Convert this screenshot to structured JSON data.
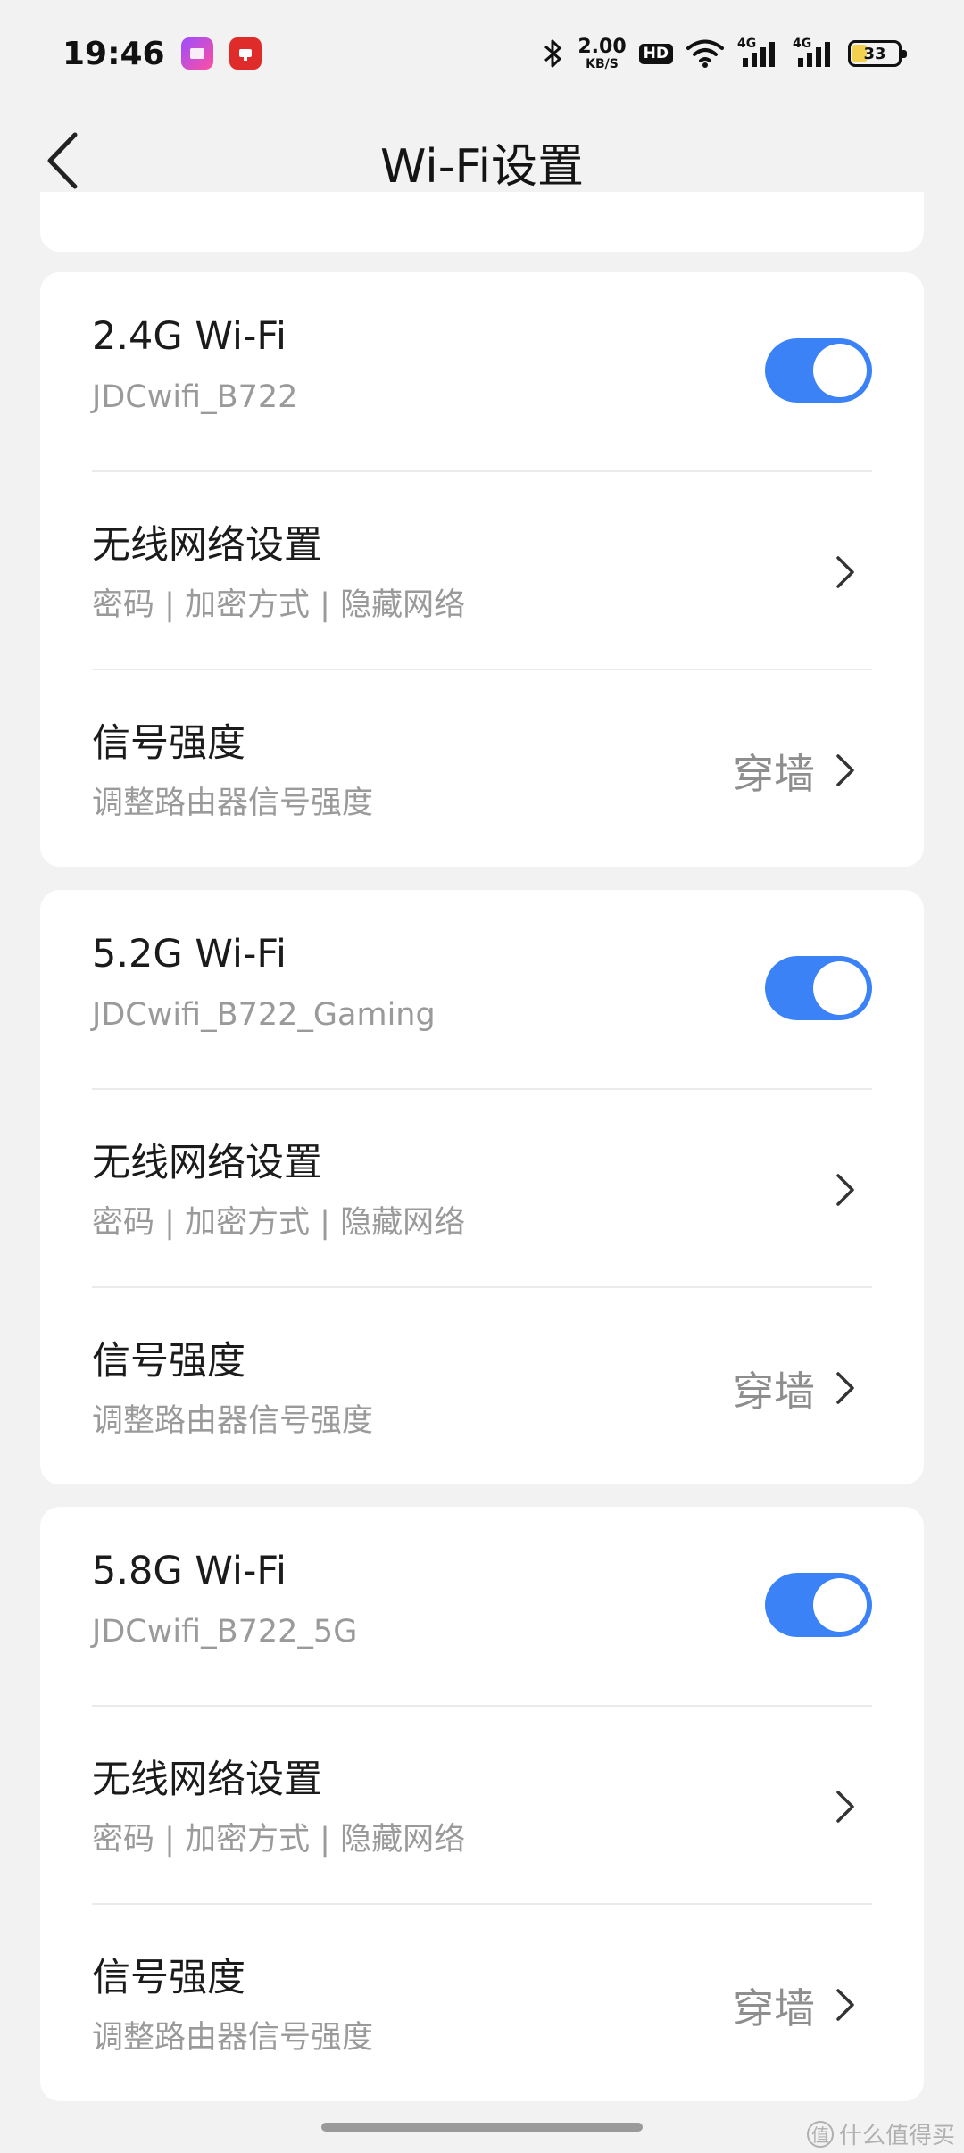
{
  "status_bar": {
    "time": "19:46",
    "net_speed_value": "2.00",
    "net_speed_unit": "KB/S",
    "hd_label": "HD",
    "network_label_1": "4G",
    "network_label_2": "4G",
    "battery_level": "33",
    "battery_fill_color": "#f3d14e"
  },
  "header": {
    "title": "Wi-Fi设置"
  },
  "sections": [
    {
      "band": "2.4G Wi-Fi",
      "ssid": "JDCwifi_B722",
      "enabled": true,
      "wireless_title": "无线网络设置",
      "wireless_sub": "密码 | 加密方式 | 隐藏网络",
      "signal_title": "信号强度",
      "signal_sub": "调整路由器信号强度",
      "signal_value": "穿墙"
    },
    {
      "band": "5.2G Wi-Fi",
      "ssid": "JDCwifi_B722_Gaming",
      "enabled": true,
      "wireless_title": "无线网络设置",
      "wireless_sub": "密码 | 加密方式 | 隐藏网络",
      "signal_title": "信号强度",
      "signal_sub": "调整路由器信号强度",
      "signal_value": "穿墙"
    },
    {
      "band": "5.8G Wi-Fi",
      "ssid": "JDCwifi_B722_5G",
      "enabled": true,
      "wireless_title": "无线网络设置",
      "wireless_sub": "密码 | 加密方式 | 隐藏网络",
      "signal_title": "信号强度",
      "signal_sub": "调整路由器信号强度",
      "signal_value": "穿墙"
    }
  ],
  "watermark": {
    "text": "什么值得买",
    "icon_glyph": "值"
  },
  "colors": {
    "accent": "#3b82f6",
    "background": "#f2f2f2"
  }
}
